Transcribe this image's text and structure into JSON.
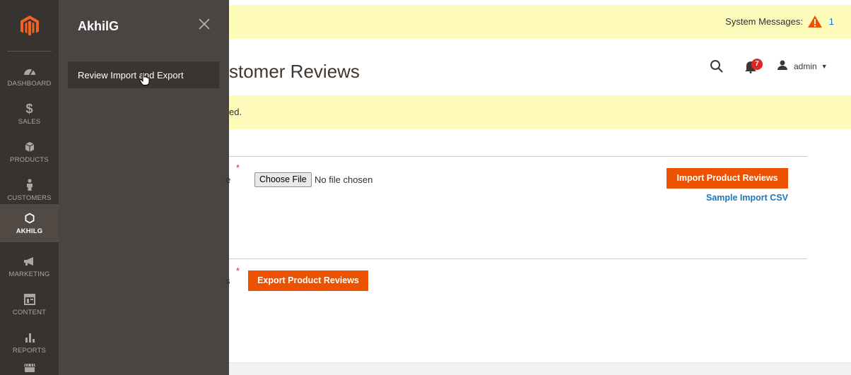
{
  "nav": {
    "logo_icon": "magento-logo-icon",
    "items": [
      {
        "label": "DASHBOARD",
        "icon": "dashboard-icon"
      },
      {
        "label": "SALES",
        "icon": "dollar-icon"
      },
      {
        "label": "PRODUCTS",
        "icon": "cube-icon"
      },
      {
        "label": "CUSTOMERS",
        "icon": "person-icon"
      },
      {
        "label": "AKHILG",
        "icon": "hexagon-icon",
        "active": true
      },
      {
        "label": "MARKETING",
        "icon": "megaphone-icon"
      },
      {
        "label": "CONTENT",
        "icon": "layout-icon"
      },
      {
        "label": "REPORTS",
        "icon": "bar-chart-icon"
      },
      {
        "label": "",
        "icon": "store-icon"
      }
    ]
  },
  "flyout": {
    "title": "AkhilG",
    "link": "Review Import and Export"
  },
  "system_messages": {
    "label": "System Messages:",
    "count": "1"
  },
  "header": {
    "title_fragment": "stomer Reviews",
    "notifications": "7",
    "user": "admin"
  },
  "message_fragment": "ed.",
  "import": {
    "label_fragment": "e",
    "file_button": "Choose File",
    "file_status": "No file chosen",
    "button": "Import Product Reviews",
    "sample_link": "Sample Import CSV"
  },
  "export": {
    "label_fragment": "s",
    "button": "Export Product Reviews"
  },
  "colors": {
    "accent": "#eb5202",
    "nav_bg": "#373330",
    "flyout_bg": "#4a4542",
    "message_bg": "#fffbbb",
    "link": "#1979c3"
  }
}
